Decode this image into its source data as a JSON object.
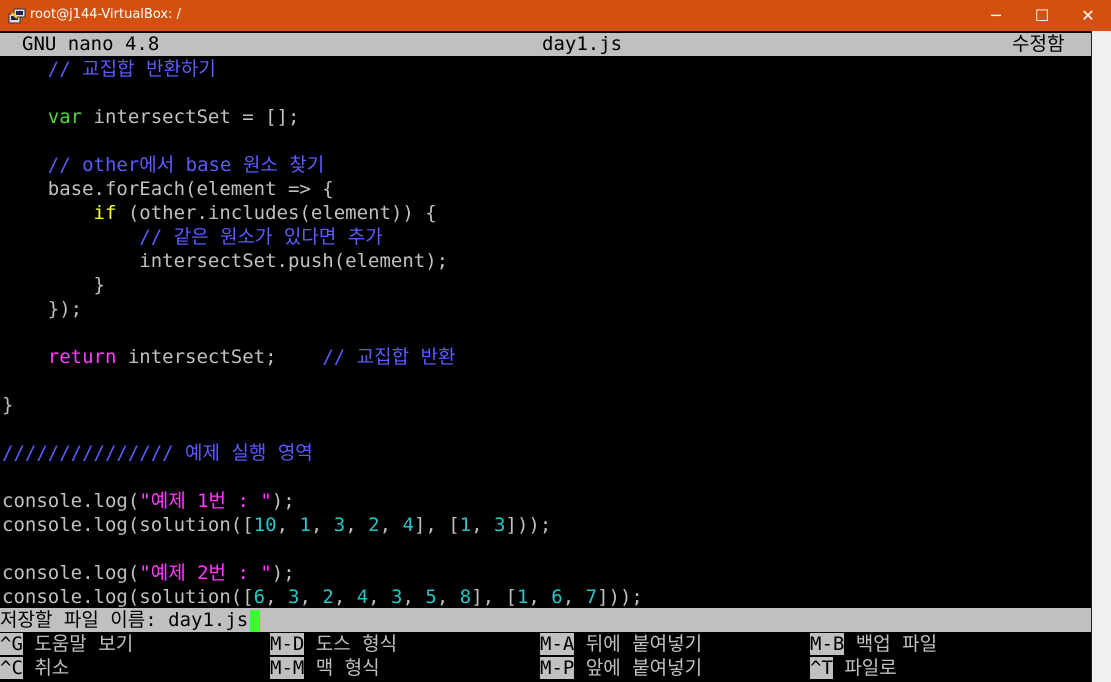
{
  "window": {
    "title": "root@j144-VirtualBox: /",
    "minimize_glyph": "─",
    "maximize_glyph": "☐",
    "close_glyph": "✕"
  },
  "nano": {
    "version": "GNU nano 4.8",
    "filename": "day1.js",
    "status": "수정함"
  },
  "code_lines": [
    [
      {
        "t": "    "
      },
      {
        "t": "// 교집합 반환하기",
        "c": "cmt"
      }
    ],
    [],
    [
      {
        "t": "    "
      },
      {
        "t": "var",
        "c": "kw-green"
      },
      {
        "t": " intersectSet = [];"
      }
    ],
    [],
    [
      {
        "t": "    "
      },
      {
        "t": "// other에서 base 원소 찾기",
        "c": "cmt"
      }
    ],
    [
      {
        "t": "    base.forEach(element => {"
      }
    ],
    [
      {
        "t": "        "
      },
      {
        "t": "if",
        "c": "kw-yellow"
      },
      {
        "t": " (other.includes(element)) {"
      }
    ],
    [
      {
        "t": "            "
      },
      {
        "t": "// 같은 원소가 있다면 추가",
        "c": "cmt"
      }
    ],
    [
      {
        "t": "            intersectSet.push(element);"
      }
    ],
    [
      {
        "t": "        }"
      }
    ],
    [
      {
        "t": "    });"
      }
    ],
    [],
    [
      {
        "t": "    "
      },
      {
        "t": "return",
        "c": "kw-magenta"
      },
      {
        "t": " intersectSet;    "
      },
      {
        "t": "// 교집합 반환",
        "c": "cmt"
      }
    ],
    [],
    [
      {
        "t": "}"
      }
    ],
    [],
    [
      {
        "t": "/////////////// 예제 실행 영역",
        "c": "cmt"
      }
    ],
    [],
    [
      {
        "t": "console.log("
      },
      {
        "t": "\"예제 1번 : \"",
        "c": "str"
      },
      {
        "t": ");"
      }
    ],
    [
      {
        "t": "console.log(solution(["
      },
      {
        "t": "10",
        "c": "num"
      },
      {
        "t": ", "
      },
      {
        "t": "1",
        "c": "num"
      },
      {
        "t": ", "
      },
      {
        "t": "3",
        "c": "num"
      },
      {
        "t": ", "
      },
      {
        "t": "2",
        "c": "num"
      },
      {
        "t": ", "
      },
      {
        "t": "4",
        "c": "num"
      },
      {
        "t": "], ["
      },
      {
        "t": "1",
        "c": "num"
      },
      {
        "t": ", "
      },
      {
        "t": "3",
        "c": "num"
      },
      {
        "t": "]));"
      }
    ],
    [],
    [
      {
        "t": "console.log("
      },
      {
        "t": "\"예제 2번 : \"",
        "c": "str"
      },
      {
        "t": ");"
      }
    ],
    [
      {
        "t": "console.log(solution(["
      },
      {
        "t": "6",
        "c": "num"
      },
      {
        "t": ", "
      },
      {
        "t": "3",
        "c": "num"
      },
      {
        "t": ", "
      },
      {
        "t": "2",
        "c": "num"
      },
      {
        "t": ", "
      },
      {
        "t": "4",
        "c": "num"
      },
      {
        "t": ", "
      },
      {
        "t": "3",
        "c": "num"
      },
      {
        "t": ", "
      },
      {
        "t": "5",
        "c": "num"
      },
      {
        "t": ", "
      },
      {
        "t": "8",
        "c": "num"
      },
      {
        "t": "], ["
      },
      {
        "t": "1",
        "c": "num"
      },
      {
        "t": ", "
      },
      {
        "t": "6",
        "c": "num"
      },
      {
        "t": ", "
      },
      {
        "t": "7",
        "c": "num"
      },
      {
        "t": "]));"
      }
    ]
  ],
  "prompt": {
    "label": "저장할 파일 이름: ",
    "value": "day1.js"
  },
  "shortcuts": [
    {
      "key": "^G",
      "label": "도움말 보기"
    },
    {
      "key": "M-D",
      "label": "도스 형식"
    },
    {
      "key": "M-A",
      "label": "뒤에 붙여넣기"
    },
    {
      "key": "M-B",
      "label": "백업 파일"
    },
    {
      "key": "^C",
      "label": "취소"
    },
    {
      "key": "M-M",
      "label": "맥 형식"
    },
    {
      "key": "M-P",
      "label": "앞에 붙여넣기"
    },
    {
      "key": "^T",
      "label": "파일로"
    }
  ]
}
